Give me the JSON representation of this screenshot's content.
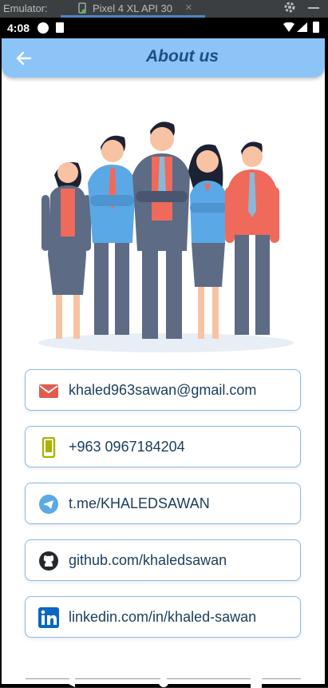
{
  "emulator": {
    "label": "Emulator:",
    "tab_title": "Pixel 4 XL API 30",
    "close_glyph": "×"
  },
  "statusbar": {
    "time": "4:08"
  },
  "appbar": {
    "title": "About us",
    "back_icon": "arrow-back-icon"
  },
  "illustration": {
    "icon": "team-people-illustration"
  },
  "contacts": [
    {
      "icon": "email-icon",
      "text": "khaled963sawan@gmail.com",
      "color": "#e25b4f"
    },
    {
      "icon": "phone-icon",
      "text": "+963 0967184204",
      "color": "#a8b400"
    },
    {
      "icon": "telegram-icon",
      "text": "t.me/KHALEDSAWAN",
      "color": "#5aa9e6"
    },
    {
      "icon": "github-icon",
      "text": "github.com/khaledsawan",
      "color": "#24292e"
    },
    {
      "icon": "linkedin-icon",
      "text": "linkedin.com/in/khaled-sawan",
      "color": "#0a66c2"
    }
  ],
  "colors": {
    "appbar": "#8cc4f7",
    "title": "#1e4f80",
    "card_border": "#8ab8e4"
  }
}
